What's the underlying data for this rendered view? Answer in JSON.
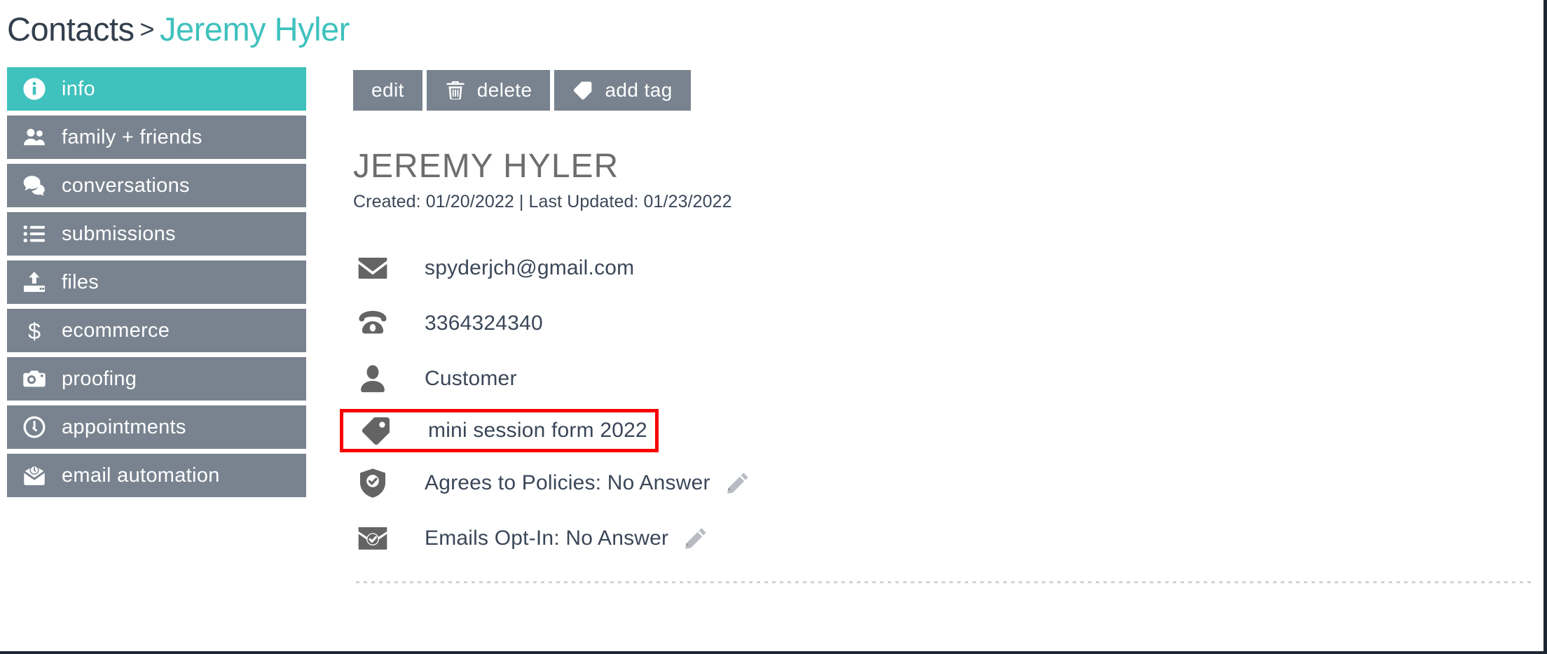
{
  "breadcrumb": {
    "root": "Contacts",
    "separator": ">",
    "current": "Jeremy Hyler"
  },
  "sidebar": {
    "items": [
      {
        "label": "info",
        "icon": "info-circle-icon",
        "active": true
      },
      {
        "label": "family + friends",
        "icon": "users-icon",
        "active": false
      },
      {
        "label": "conversations",
        "icon": "chat-bubbles-icon",
        "active": false
      },
      {
        "label": "submissions",
        "icon": "list-icon",
        "active": false
      },
      {
        "label": "files",
        "icon": "upload-icon",
        "active": false
      },
      {
        "label": "ecommerce",
        "icon": "dollar-sign-icon",
        "active": false
      },
      {
        "label": "proofing",
        "icon": "camera-icon",
        "active": false
      },
      {
        "label": "appointments",
        "icon": "clock-icon",
        "active": false
      },
      {
        "label": "email automation",
        "icon": "email-clock-icon",
        "active": false
      }
    ]
  },
  "toolbar": {
    "buttons": [
      {
        "label": "edit",
        "icon": null
      },
      {
        "label": "delete",
        "icon": "trash-icon"
      },
      {
        "label": "add tag",
        "icon": "tag-icon"
      }
    ]
  },
  "contact": {
    "name": "JEREMY HYLER",
    "meta": "Created: 01/20/2022 | Last Updated: 01/23/2022",
    "details": [
      {
        "icon": "envelope-icon",
        "text": "spyderjch@gmail.com",
        "pencil": false,
        "highlighted": false
      },
      {
        "icon": "phone-icon",
        "text": "3364324340",
        "pencil": false,
        "highlighted": false
      },
      {
        "icon": "person-icon",
        "text": "Customer",
        "pencil": false,
        "highlighted": false
      },
      {
        "icon": "tag-icon",
        "text": "mini session form 2022",
        "pencil": false,
        "highlighted": true
      },
      {
        "icon": "shield-check-icon",
        "text": "Agrees to Policies: No Answer",
        "pencil": true,
        "highlighted": false
      },
      {
        "icon": "envelope-check-icon",
        "text": "Emails Opt-In: No Answer",
        "pencil": true,
        "highlighted": false
      }
    ]
  },
  "colors": {
    "accent_teal": "#3fc1bd",
    "nav_gray": "#78838f",
    "text_dark": "#3b4758",
    "highlight_red": "#f90000",
    "icon_gray": "#646464"
  }
}
